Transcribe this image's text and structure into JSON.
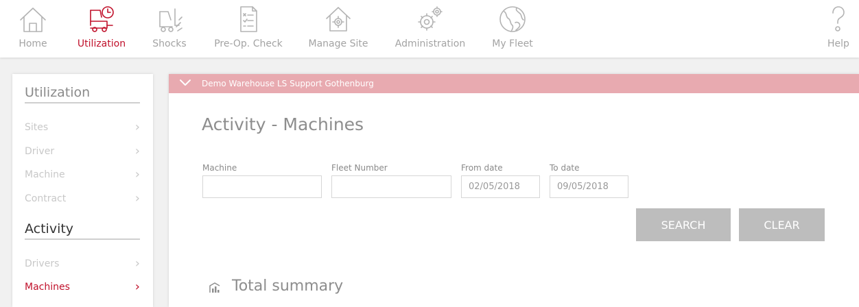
{
  "nav": {
    "items": [
      {
        "label": "Home",
        "icon": "home-icon",
        "active": false
      },
      {
        "label": "Utilization",
        "icon": "forklift-clock-icon",
        "active": true
      },
      {
        "label": "Shocks",
        "icon": "forklift-shock-icon",
        "active": false
      },
      {
        "label": "Pre-Op. Check",
        "icon": "checklist-icon",
        "active": false
      },
      {
        "label": "Manage Site",
        "icon": "house-gear-icon",
        "active": false
      },
      {
        "label": "Administration",
        "icon": "gears-icon",
        "active": false
      },
      {
        "label": "My Fleet",
        "icon": "globe-icon",
        "active": false
      }
    ],
    "help": {
      "label": "Help",
      "icon": "help-icon"
    }
  },
  "sidebar": {
    "utilization": {
      "title": "Utilization",
      "items": [
        {
          "label": "Sites"
        },
        {
          "label": "Driver"
        },
        {
          "label": "Machine"
        },
        {
          "label": "Contract"
        }
      ]
    },
    "activity": {
      "title": "Activity",
      "items": [
        {
          "label": "Drivers",
          "active": false
        },
        {
          "label": "Machines",
          "active": true
        }
      ]
    }
  },
  "site": {
    "name": "Demo Warehouse LS Support Gothenburg"
  },
  "main": {
    "title": "Activity - Machines",
    "form": {
      "machine": {
        "label": "Machine",
        "value": ""
      },
      "fleet_number": {
        "label": "Fleet Number",
        "value": ""
      },
      "from_date": {
        "label": "From date",
        "value": "02/05/2018"
      },
      "to_date": {
        "label": "To date",
        "value": "09/05/2018"
      }
    },
    "search_label": "SEARCH",
    "clear_label": "CLEAR",
    "summary_title": "Total summary"
  },
  "colors": {
    "accent": "#c0102a",
    "site_bar": "#e8aab0",
    "button": "#bdbdbd"
  }
}
